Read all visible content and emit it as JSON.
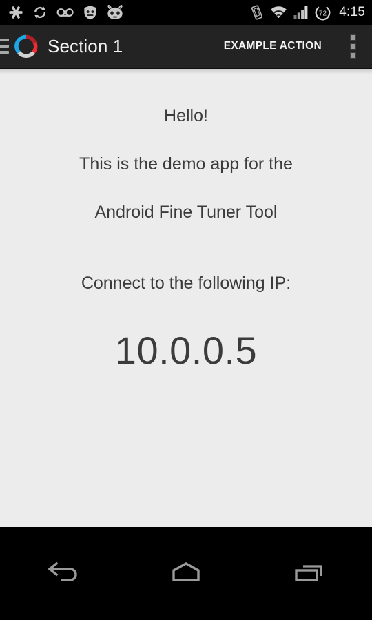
{
  "status_bar": {
    "left_icons": [
      {
        "name": "settings-asterisk-icon",
        "label": "Settings"
      },
      {
        "name": "sync-icon",
        "label": "Sync"
      },
      {
        "name": "voicemail-icon",
        "label": "Voicemail"
      },
      {
        "name": "privacy-guard-icon",
        "label": "Privacy Guard"
      },
      {
        "name": "cyanogenmod-icon",
        "label": "CyanogenMod"
      }
    ],
    "right_icons": [
      {
        "name": "vibrate-icon",
        "label": "Vibrate"
      },
      {
        "name": "wifi-icon",
        "label": "Wi-Fi"
      },
      {
        "name": "cellular-signal-icon",
        "label": "Cellular signal"
      }
    ],
    "battery": {
      "level": "72",
      "name": "battery-circle-icon"
    },
    "clock": "4:15"
  },
  "action_bar": {
    "up_icon": "hamburger-menu-icon",
    "logo_name": "app-logo-ring",
    "title": "Section 1",
    "action_label": "EXAMPLE ACTION",
    "overflow_icon": "overflow-menu-icon"
  },
  "content": {
    "greeting": "Hello!",
    "description_line1": "This is the demo app for the",
    "description_line2": "Android Fine Tuner Tool",
    "connect_label": "Connect to the following IP:",
    "ip_address": "10.0.0.5"
  },
  "nav_bar": {
    "back_label": "Back",
    "home_label": "Home",
    "recents_label": "Recent apps"
  },
  "colors": {
    "status_bar_bg": "#000000",
    "action_bar_bg": "#232323",
    "content_bg": "#ececed",
    "nav_bar_bg": "#000000",
    "text_primary": "#3b3b3b",
    "logo_red": "#e02a32",
    "logo_blue": "#1aa5e0",
    "logo_gray": "#cfcfcf",
    "nav_icon": "#9a9a9a"
  }
}
